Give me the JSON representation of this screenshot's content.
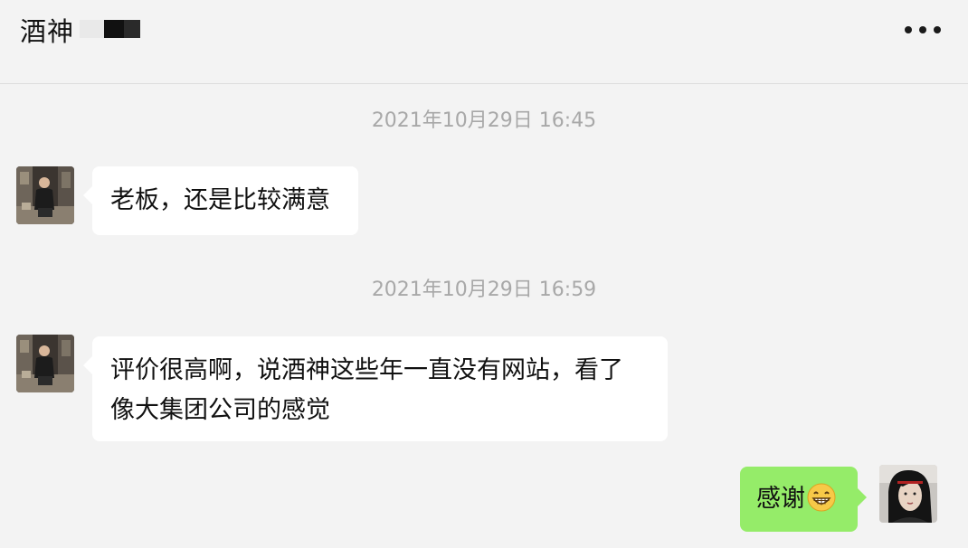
{
  "header": {
    "title": "酒神",
    "more_icon": "more-horizontal-icon"
  },
  "messages": [
    {
      "timestamp": "2021年10月29日 16:45",
      "side": "left",
      "text": "老板，还是比较满意"
    },
    {
      "timestamp": "2021年10月29日 16:59",
      "side": "left",
      "text_line1": "评价很高啊，说酒神这些年一直没有网站，看了",
      "text_line2": "像大集团公司的感觉"
    },
    {
      "side": "right",
      "text": "感谢",
      "emoji": "grinning-face-icon"
    }
  ],
  "colors": {
    "background": "#f3f3f3",
    "incoming_bubble": "#ffffff",
    "outgoing_bubble": "#95ec69",
    "timestamp_text": "#a8a8a8"
  }
}
